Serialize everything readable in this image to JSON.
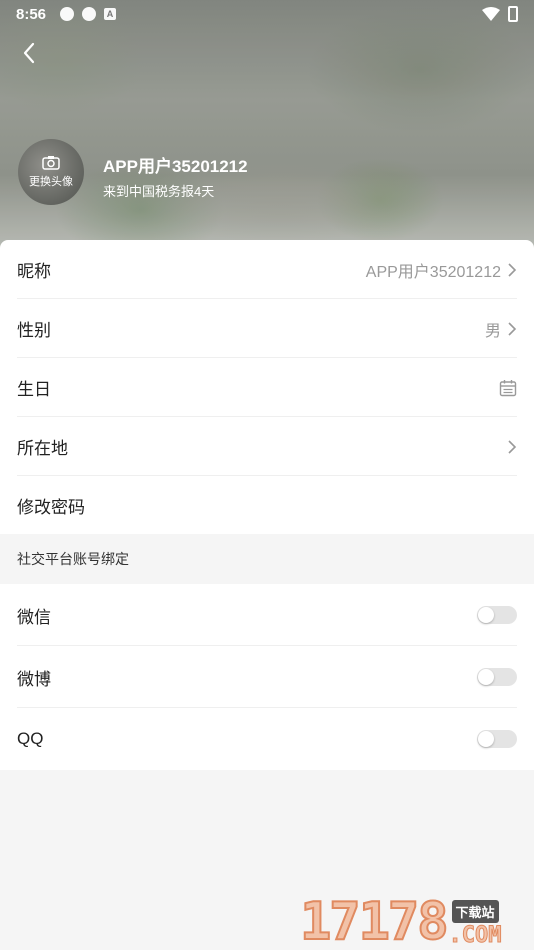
{
  "status_bar": {
    "time": "8:56",
    "notif_icon_letter": "A"
  },
  "header": {
    "avatar_label": "更换头像",
    "username": "APP用户35201212",
    "subtitle": "来到中国税务报4天"
  },
  "profile_rows": [
    {
      "label": "昵称",
      "value": "APP用户35201212",
      "icon": "chevron-right-icon"
    },
    {
      "label": "性别",
      "value": "男",
      "icon": "chevron-right-icon"
    },
    {
      "label": "生日",
      "value": "",
      "icon": "calendar-icon"
    },
    {
      "label": "所在地",
      "value": "",
      "icon": "chevron-right-icon"
    },
    {
      "label": "修改密码",
      "value": "",
      "icon": ""
    }
  ],
  "social_section": {
    "title": "社交平台账号绑定",
    "items": [
      {
        "label": "微信",
        "bound": false
      },
      {
        "label": "微博",
        "bound": false
      },
      {
        "label": "QQ",
        "bound": false
      }
    ]
  },
  "watermark": {
    "number": "17178",
    "tag": "下载站",
    "suffix": ".COM"
  }
}
